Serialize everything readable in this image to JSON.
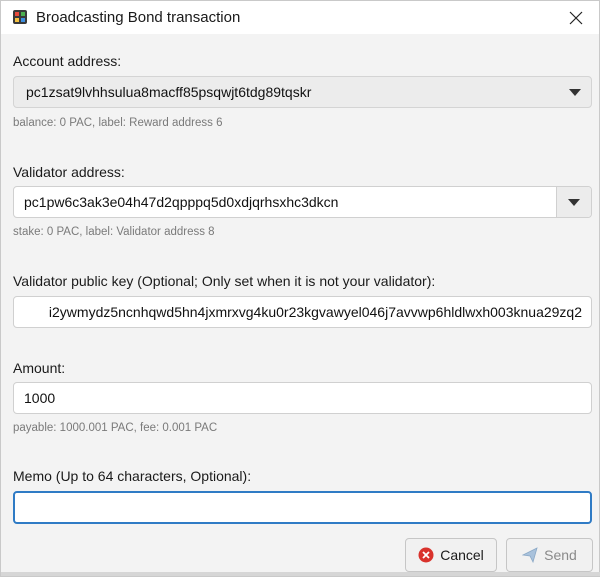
{
  "window": {
    "title": "Broadcasting Bond transaction"
  },
  "account": {
    "label": "Account address:",
    "value": "pc1zsat9lvhhsulua8macff85psqwjt6tdg89tqskr",
    "hint": "balance: 0 PAC, label: Reward address 6"
  },
  "validator": {
    "label": "Validator address:",
    "value": "pc1pw6c3ak3e04h47d2qpppq5d0xdjqrhsxhc3dkcn",
    "hint": "stake: 0 PAC, label: Validator address 8"
  },
  "public_key": {
    "label": "Validator public key (Optional; Only set when it is not your validator):",
    "value": "i2ywmydz5ncnhqwd5hn4jxmrxvg4ku0r23kgvawyel046j7avvwp6hldlwxh003knua29zq2"
  },
  "amount": {
    "label": "Amount:",
    "value": "1000",
    "hint": "payable: 1000.001 PAC, fee: 0.001 PAC"
  },
  "memo": {
    "label": "Memo (Up to 64 characters, Optional):",
    "value": ""
  },
  "buttons": {
    "cancel": "Cancel",
    "send": "Send"
  },
  "icons": {
    "app": "app-cube-icon",
    "close": "close-icon",
    "cancel": "cancel-circle-icon",
    "send": "send-plane-icon"
  },
  "colors": {
    "focus_border": "#2f7bc5",
    "cancel_icon": "#d9322c"
  }
}
